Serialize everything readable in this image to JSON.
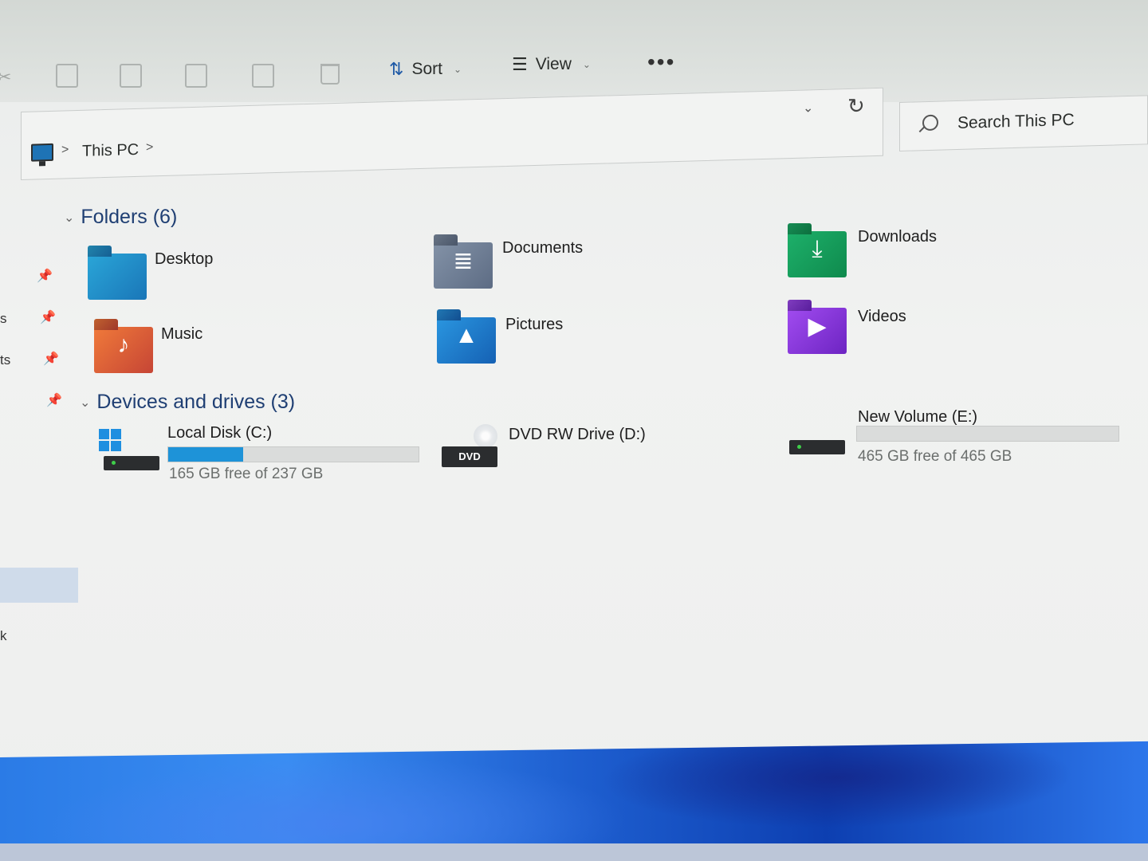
{
  "toolbar": {
    "sort_label": "Sort",
    "view_label": "View",
    "more_label": "•••"
  },
  "address": {
    "breadcrumb": [
      "This PC"
    ],
    "separator": ">"
  },
  "search": {
    "placeholder": "Search This PC"
  },
  "nav": {
    "fragments": [
      "s",
      "ts",
      "k"
    ]
  },
  "folders": {
    "header": "Folders (6)",
    "items": [
      {
        "label": "Desktop",
        "icon": "desktop-folder-icon",
        "color": "#1a76b8"
      },
      {
        "label": "Documents",
        "icon": "documents-folder-icon",
        "color": "#5d6c84"
      },
      {
        "label": "Downloads",
        "icon": "downloads-folder-icon",
        "color": "#0f8a4d"
      },
      {
        "label": "Music",
        "icon": "music-folder-icon",
        "color": "#c64535"
      },
      {
        "label": "Pictures",
        "icon": "pictures-folder-icon",
        "color": "#1561b4"
      },
      {
        "label": "Videos",
        "icon": "videos-folder-icon",
        "color": "#6d24c2"
      }
    ]
  },
  "drives": {
    "header": "Devices and drives (3)",
    "items": [
      {
        "label": "Local Disk (C:)",
        "free_text": "165 GB free of 237 GB",
        "used_fraction": 0.3,
        "icon": "windows-drive-icon"
      },
      {
        "label": "DVD RW Drive (D:)",
        "badge": "DVD",
        "icon": "dvd-drive-icon"
      },
      {
        "label": "New Volume (E:)",
        "free_text": "465 GB free of 465 GB",
        "used_fraction": 0.0,
        "icon": "hard-drive-icon"
      }
    ]
  },
  "colors": {
    "accent": "#1e93d8",
    "section_header": "#1f3f73"
  }
}
